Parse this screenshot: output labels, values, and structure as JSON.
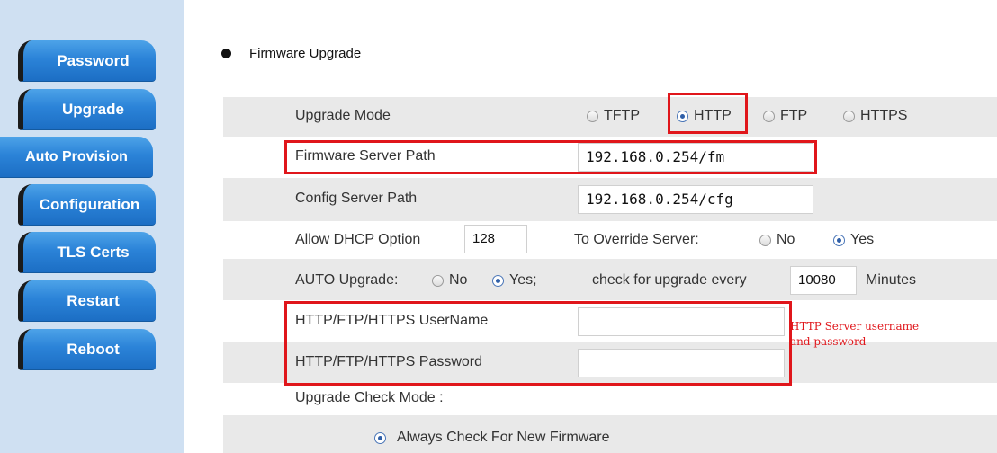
{
  "sidebar": {
    "items": [
      {
        "label": "Password"
      },
      {
        "label": "Upgrade"
      },
      {
        "label": "Auto Provision"
      },
      {
        "label": "Configuration"
      },
      {
        "label": "TLS Certs"
      },
      {
        "label": "Restart"
      },
      {
        "label": "Reboot"
      }
    ]
  },
  "section": {
    "title": "Firmware Upgrade"
  },
  "upgrade_mode": {
    "label": "Upgrade Mode",
    "options": [
      "TFTP",
      "HTTP",
      "FTP",
      "HTTPS"
    ],
    "selected": "HTTP"
  },
  "firmware_path": {
    "label": "Firmware Server Path",
    "value": "192.168.0.254/fm"
  },
  "config_path": {
    "label": "Config Server Path",
    "value": "192.168.0.254/cfg"
  },
  "dhcp": {
    "label": "Allow DHCP Option",
    "value": "128"
  },
  "override": {
    "label": "To Override Server:",
    "no": "No",
    "yes": "Yes",
    "selected": "Yes"
  },
  "auto_upgrade": {
    "label": "AUTO Upgrade:",
    "no": "No",
    "yes": "Yes;",
    "selected": "Yes",
    "check_label": "check for upgrade every",
    "interval": "10080",
    "unit": "Minutes"
  },
  "username": {
    "label": "HTTP/FTP/HTTPS UserName",
    "value": ""
  },
  "password": {
    "label": "HTTP/FTP/HTTPS Password",
    "value": ""
  },
  "annotation": {
    "line1": "HTTP Server username",
    "line2": "and password"
  },
  "check_mode": {
    "label": "Upgrade Check Mode :",
    "option": "Always Check For New Firmware"
  },
  "colors": {
    "highlight": "#e0161b",
    "nav": "#2b83d8",
    "row_shade": "#e9e9e9"
  }
}
